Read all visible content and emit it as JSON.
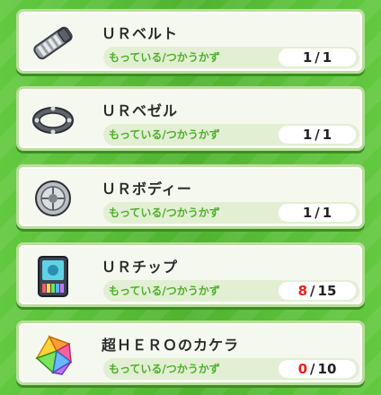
{
  "items": [
    {
      "name": "ＵＲベルト",
      "label_have": "もっている",
      "label_sep": "/",
      "label_use": "つかうかず",
      "have": "1",
      "sep": "/",
      "use": "1",
      "have_color": "#222222",
      "icon": "belt-icon"
    },
    {
      "name": "ＵＲベゼル",
      "label_have": "もっている",
      "label_sep": "/",
      "label_use": "つかうかず",
      "have": "1",
      "sep": "/",
      "use": "1",
      "have_color": "#222222",
      "icon": "bezel-icon"
    },
    {
      "name": "ＵＲボディー",
      "label_have": "もっている",
      "label_sep": "/",
      "label_use": "つかうかず",
      "have": "1",
      "sep": "/",
      "use": "1",
      "have_color": "#222222",
      "icon": "body-icon"
    },
    {
      "name": "ＵＲチップ",
      "label_have": "もっている",
      "label_sep": "/",
      "label_use": "つかうかず",
      "have": "8",
      "sep": "/",
      "use": "15",
      "have_color": "#e8201c",
      "icon": "chip-icon"
    },
    {
      "name": "超ＨＥＲＯのカケラ",
      "label_have": "もっている",
      "label_sep": "/",
      "label_use": "つかうかず",
      "have": "0",
      "sep": "/",
      "use": "10",
      "have_color": "#e8201c",
      "icon": "hero-fragment-icon"
    }
  ]
}
